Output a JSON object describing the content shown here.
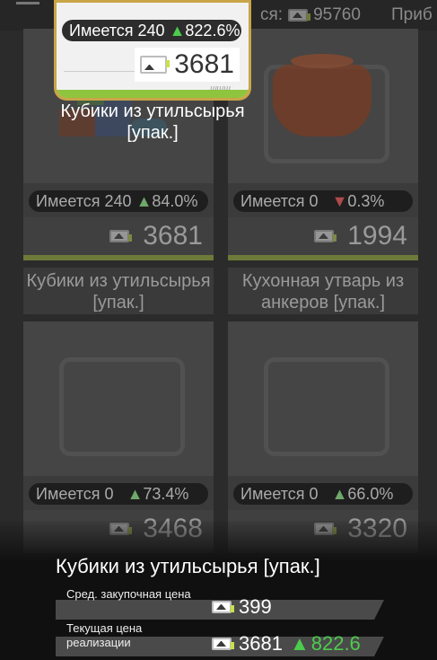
{
  "topbar": {
    "funds_label_partial": "ся:",
    "funds_value": "95760",
    "profit_label_partial": "Приб"
  },
  "selected": {
    "stock": "Имеется 240",
    "change": "822.6%",
    "price": "3681",
    "unit": "шщщ",
    "name": "Кубики из утильсырья [упак.]"
  },
  "cards": [
    {
      "stock": "Имеется 240",
      "change": "84.0%",
      "direction": "up",
      "price": "3681",
      "name": "Кубики из утильсырья [упак.]"
    },
    {
      "stock": "Имеется 0",
      "change": "0.3%",
      "direction": "down",
      "price": "1994",
      "name": "Кухонная утварь из анкеров [упак.]"
    },
    {
      "stock": "Имеется 0",
      "change": "73.4%",
      "direction": "up",
      "price": "3468",
      "name": ""
    },
    {
      "stock": "Имеется 0",
      "change": "66.0%",
      "direction": "up",
      "price": "3320",
      "name": ""
    }
  ],
  "info": {
    "title": "Кубики из утильсырья [упак.]",
    "avg_buy_label": "Сред. закупочная цена",
    "avg_buy_value": "399",
    "current_sell_label": "Текущая цена реализации",
    "current_sell_value": "3681",
    "current_sell_change": "822.6"
  },
  "colors": {
    "up": "#4ccc4c",
    "down": "#c94040",
    "accent_bar": "#8fc43e",
    "selection_border": "#c9a548"
  },
  "icons": {
    "cash": "cash-icon",
    "up": "triangle-up",
    "down": "triangle-down"
  }
}
